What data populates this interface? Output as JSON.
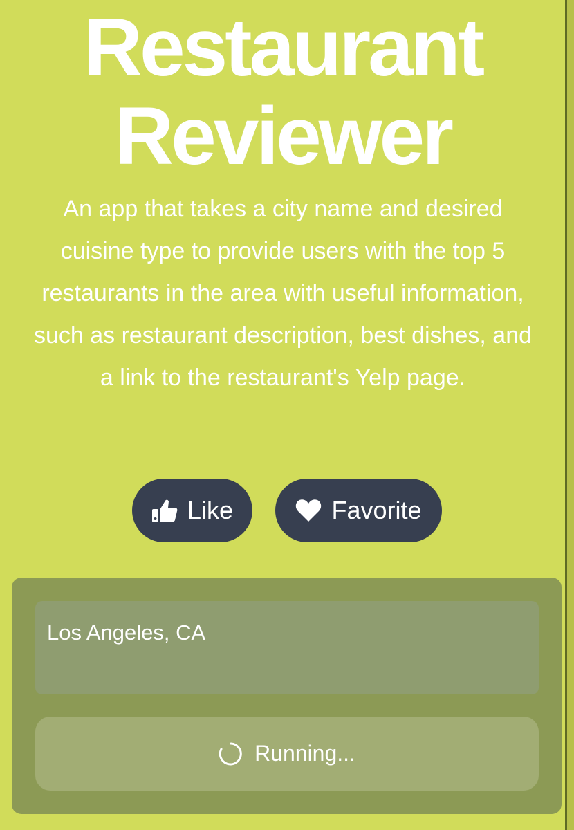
{
  "header": {
    "title_line1": "Restaurant",
    "title_line2": "Reviewer",
    "description": "An app that takes a city name and desired cuisine type to provide users with the top 5 restaurants in the area with useful information, such as restaurant description, best dishes, and a link to the restaurant's Yelp page."
  },
  "actions": {
    "like_label": "Like",
    "favorite_label": "Favorite",
    "like_icon": "thumbs-up-icon",
    "favorite_icon": "heart-icon"
  },
  "form": {
    "location_value": "Los Angeles, CA",
    "run_label": "Running...",
    "run_icon": "loading-spinner-icon"
  },
  "colors": {
    "background": "#d1dc5a",
    "button_dark": "#373f50",
    "panel": "#8c9a55",
    "input": "#8f9d70",
    "run_button": "#a2ad74",
    "text": "#ffffff"
  }
}
